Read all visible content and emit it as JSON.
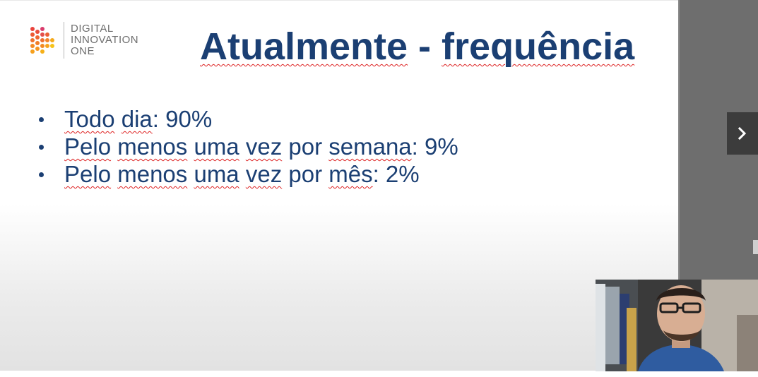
{
  "logo": {
    "lines": [
      "DIGITAL",
      "INNOVATION",
      "ONE"
    ]
  },
  "slide": {
    "title_part1": "Atualmente",
    "title_sep": " - ",
    "title_part2": "frequência",
    "bullets": [
      {
        "w1": "Todo",
        "w2": "dia",
        "rest": ": 90%"
      },
      {
        "w1": "Pelo",
        "w2": "menos",
        "w3": "uma",
        "w4": "vez",
        "w5": " por ",
        "w6": "semana",
        "rest": ": 9%"
      },
      {
        "w1": "Pelo",
        "w2": "menos",
        "w3": "uma",
        "w4": "vez",
        "w5": " por ",
        "w6": "mês",
        "rest": ": 2%"
      }
    ]
  },
  "colors": {
    "title": "#1b3f73",
    "spellcheck": "#dd2222",
    "side_panel": "#6e6e6e",
    "next_button": "#3c3c3c"
  },
  "icons": {
    "logo": "dots-play-logo-icon",
    "next": "chevron-right-icon"
  }
}
